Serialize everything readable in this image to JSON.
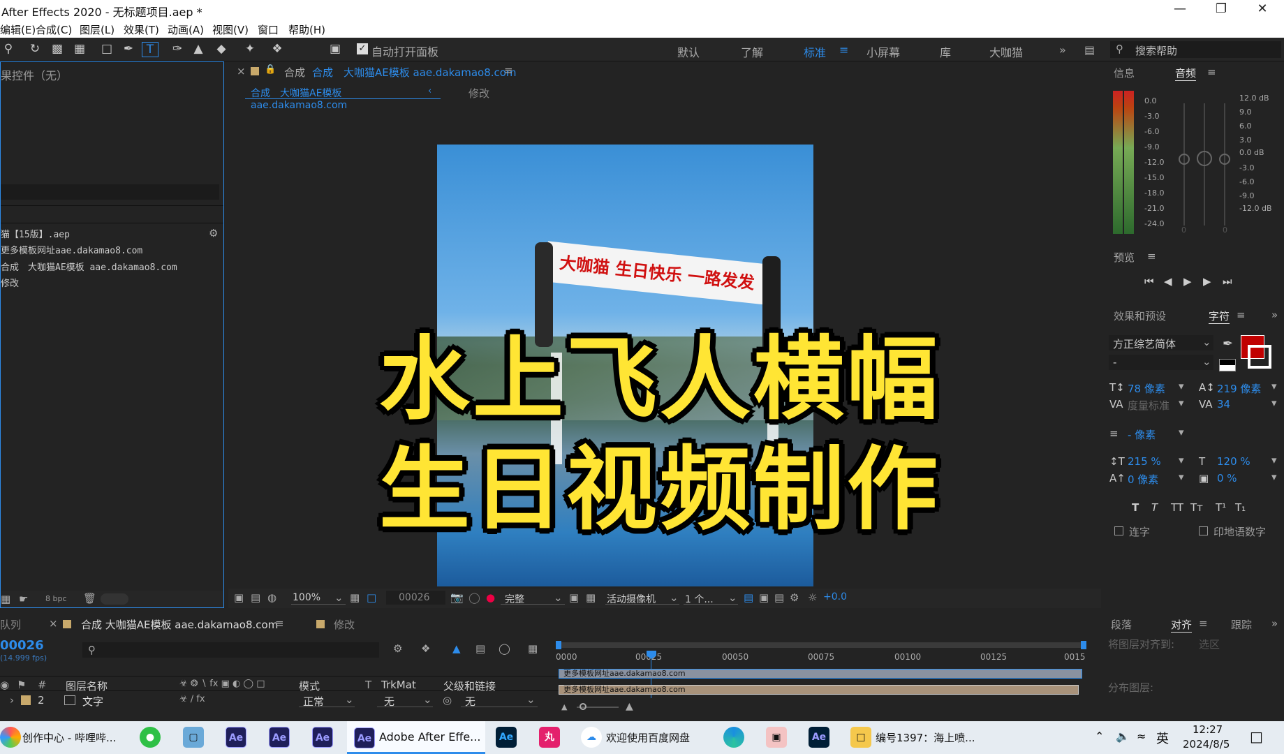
{
  "window": {
    "title": "After Effects 2020 - 无标题项目.aep *"
  },
  "menu": [
    "编辑(E)",
    "合成(C)",
    "图层(L)",
    "效果(T)",
    "动画(A)",
    "视图(V)",
    "窗口",
    "帮助(H)"
  ],
  "toolbar": {
    "auto_open_label": "自动打开面板",
    "workspaces": [
      "默认",
      "了解",
      "标准",
      "小屏幕",
      "库",
      "大咖猫"
    ],
    "active_workspace": "标准",
    "search_placeholder": "搜索帮助"
  },
  "left_panel": {
    "effects_controls_title": "果控件（无）",
    "project_items": [
      "猫【15版】.aep",
      "更多模板网址aae.dakamao8.com",
      "合成　大咖猫AE模板 aae.dakamao8.com",
      "修改"
    ],
    "bpc": "8 bpc"
  },
  "composition": {
    "tab_label": "合成",
    "tab_name": "合成　大咖猫AE模板 aae.dakamao8.com",
    "breadcrumb": "合成　大咖猫AE模板 aae.dakamao8.com",
    "breadcrumb_next": "修改",
    "banner_text": "大咖猫  生日快乐  一路发发",
    "overlay_line1": "水上飞人横幅",
    "overlay_line2": "生日视频制作",
    "zoom": "100%",
    "timecode": "00026",
    "resolution": "完整",
    "camera": "活动摄像机",
    "views": "1 个...",
    "exposure": "+0.0"
  },
  "right_panel": {
    "info_tab": "信息",
    "audio_tab": "音频",
    "left_scale": [
      "0.0",
      "-3.0",
      "-6.0",
      "-9.0",
      "-12.0",
      "-15.0",
      "-18.0",
      "-21.0",
      "-24.0"
    ],
    "right_scale": [
      "12.0 dB",
      "9.0",
      "6.0",
      "3.0",
      "0.0 dB",
      "-3.0",
      "-6.0",
      "-9.0",
      "-12.0 dB"
    ],
    "slider_zero": "0",
    "preview_title": "预览",
    "effects_presets": "效果和预设",
    "character_tab": "字符",
    "font_name": "方正综艺简体",
    "font_style": "-",
    "font_size": "78 像素",
    "leading": "219 像素",
    "kerning": "度量标准",
    "tracking": "34",
    "stroke": "- 像素",
    "vscale": "215 %",
    "hscale": "120 %",
    "baseline": "0 像素",
    "tsume": "0 %",
    "ligature": "连字",
    "hindi": "印地语数字",
    "accent_color": "#c00000",
    "paragraph_tab": "段落",
    "align_tab": "对齐",
    "track_tab": "跟踪",
    "align_to": "将图层对齐到:",
    "align_to_value": "选区",
    "distribute": "分布图层:"
  },
  "timeline": {
    "queue_tab": "队列",
    "comp_tab": "合成 大咖猫AE模板 aae.dakamao8.com",
    "modify_tab": "修改",
    "timecode": "00026",
    "fps": "(14.999 fps)",
    "headers": {
      "num": "#",
      "layer_name": "图层名称",
      "mode": "模式",
      "t": "T",
      "trkmat": "TrkMat",
      "parent": "父级和链接"
    },
    "layer": {
      "index": "2",
      "name": "文字",
      "mode": "正常",
      "trkmat": "无",
      "parent": "无"
    },
    "ruler": [
      "0000",
      "00025",
      "00050",
      "00075",
      "00100",
      "00125",
      "0015"
    ],
    "bar1": "更多模板网址aae.dakamao8.com",
    "bar2": "更多模板网址aae.dakamao8.com"
  },
  "taskbar": {
    "first_app": "创作中心 - 哔哩哔...",
    "active_app": "Adobe After Effe...",
    "baidu": "欢迎使用百度网盘",
    "folder": "编号1397：海上喷...",
    "ime": "英",
    "time": "12:27",
    "date": "2024/8/5"
  }
}
